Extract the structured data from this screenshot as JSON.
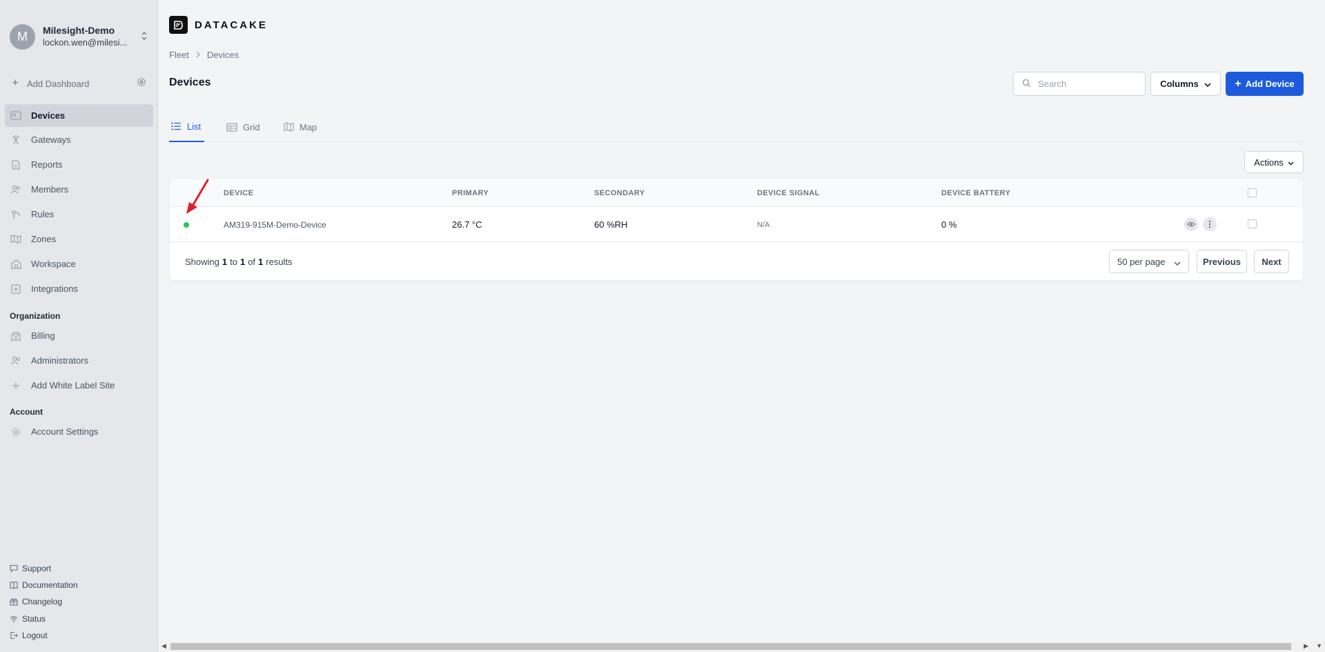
{
  "org": {
    "avatar_letter": "M",
    "name": "Milesight-Demo",
    "email": "lockon.wen@milesi..."
  },
  "sidebar": {
    "add_dashboard": "Add Dashboard",
    "items": [
      {
        "label": "Devices",
        "icon": "devices-icon",
        "active": true
      },
      {
        "label": "Gateways",
        "icon": "gateway-icon"
      },
      {
        "label": "Reports",
        "icon": "report-icon"
      },
      {
        "label": "Members",
        "icon": "members-icon"
      },
      {
        "label": "Rules",
        "icon": "rules-icon"
      },
      {
        "label": "Zones",
        "icon": "map-icon"
      },
      {
        "label": "Workspace",
        "icon": "workspace-icon"
      },
      {
        "label": "Integrations",
        "icon": "integrations-icon"
      }
    ],
    "org_section": "Organization",
    "org_items": [
      {
        "label": "Billing",
        "icon": "billing-icon"
      },
      {
        "label": "Administrators",
        "icon": "administrators-icon"
      },
      {
        "label": "Add White Label Site",
        "icon": "plus-icon"
      }
    ],
    "account_section": "Account",
    "account_items": [
      {
        "label": "Account Settings",
        "icon": "gear-icon"
      }
    ],
    "footer": [
      {
        "label": "Support",
        "icon": "chat-icon"
      },
      {
        "label": "Documentation",
        "icon": "book-icon"
      },
      {
        "label": "Changelog",
        "icon": "gift-icon"
      },
      {
        "label": "Status",
        "icon": "wifi-icon"
      },
      {
        "label": "Logout",
        "icon": "logout-icon"
      }
    ]
  },
  "brand": {
    "name": "DATACAKE"
  },
  "breadcrumb": {
    "root": "Fleet",
    "current": "Devices"
  },
  "page": {
    "title": "Devices"
  },
  "toolbar": {
    "search_placeholder": "Search",
    "columns_label": "Columns",
    "add_label": "Add Device",
    "actions_label": "Actions"
  },
  "tabs": [
    {
      "label": "List",
      "active": true
    },
    {
      "label": "Grid"
    },
    {
      "label": "Map"
    }
  ],
  "table": {
    "headers": {
      "device": "DEVICE",
      "primary": "PRIMARY",
      "secondary": "SECONDARY",
      "signal": "DEVICE SIGNAL",
      "battery": "DEVICE BATTERY"
    },
    "rows": [
      {
        "status": "online",
        "device": "AM319-915M-Demo-Device",
        "primary": "26.7 °C",
        "secondary": "60 %RH",
        "signal": "N/A",
        "battery": "0 %"
      }
    ]
  },
  "pagination": {
    "showing": "Showing",
    "from": "1",
    "to_word": "to",
    "to": "1",
    "of_word": "of",
    "total": "1",
    "results_word": "results",
    "per_page": "50 per page",
    "previous": "Previous",
    "next": "Next"
  },
  "colors": {
    "accent": "#1d5bdc",
    "online": "#22c55e",
    "annotation": "#e11d2a"
  }
}
